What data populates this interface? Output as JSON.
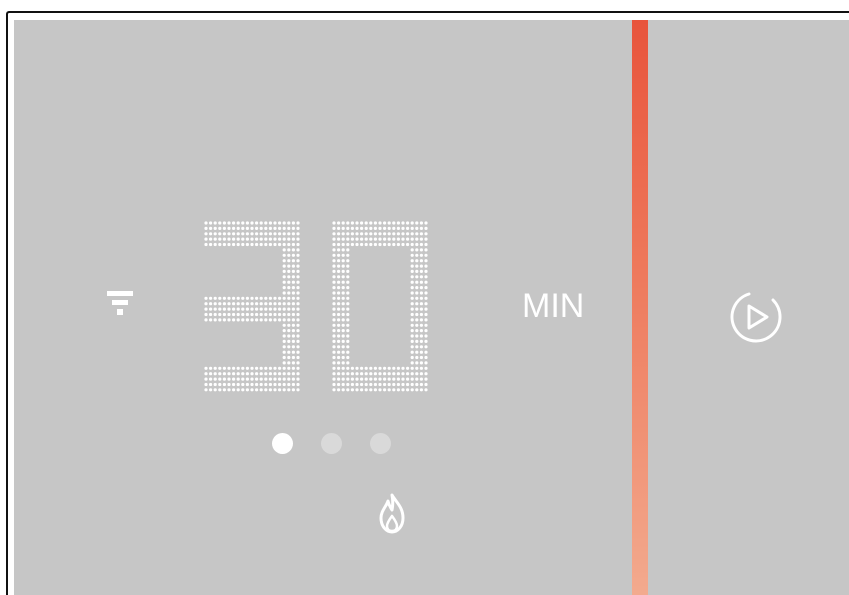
{
  "thermostat": {
    "value": "30",
    "unit": "MIN",
    "page_indicator": {
      "total": 3,
      "active": 1
    },
    "accent_color": "#e8543c",
    "screen_color": "#c6c6c6",
    "icons": {
      "signal": "wifi-signal-icon",
      "mode": "flame-icon",
      "start": "play-circle-icon"
    }
  }
}
